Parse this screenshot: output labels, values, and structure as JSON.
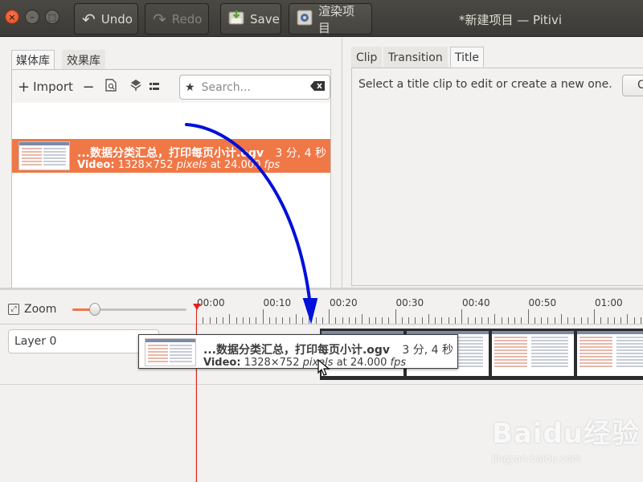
{
  "window": {
    "title": "*新建项目 — Pitivi",
    "controls": {
      "close": "×",
      "minimize": "–",
      "maximize": "□"
    }
  },
  "toolbar": {
    "undo": {
      "label": "Undo",
      "icon": "undo-arrow-icon"
    },
    "redo": {
      "label": "Redo",
      "icon": "redo-arrow-icon"
    },
    "save": {
      "label": "Save",
      "icon": "save-icon"
    },
    "render": {
      "label": "渲染项目",
      "icon": "render-gear-icon"
    }
  },
  "media_library": {
    "tabs": [
      "媒体库",
      "效果库"
    ],
    "active_tab": 0,
    "import_label": "Import",
    "search": {
      "placeholder": "Search...",
      "value": ""
    },
    "items": [
      {
        "name": "...数据分类汇总，打印每页小计.ogv",
        "duration": "3 分, 4 秒",
        "info_prefix": "Video:",
        "info_size": "1328×752",
        "info_unit": "pixels",
        "info_at": "at 24.000",
        "info_fps": "fps",
        "selected": true
      }
    ]
  },
  "clip_panel": {
    "tabs": [
      "Clip",
      "Transition",
      "Title"
    ],
    "active_tab": 2,
    "hint": "Select a title clip to edit or create a new one.",
    "create_button": "Create"
  },
  "timeline": {
    "zoom_label": "Zoom",
    "zoom_level": 0.2,
    "ruler_labels": [
      "00:00",
      "00:10",
      "00:20",
      "00:30",
      "00:40",
      "00:50",
      "01:00"
    ],
    "layer_name": "Layer 0"
  },
  "drag_tooltip": {
    "name": "...数据分类汇总，打印每页小计.ogv",
    "duration": "3 分, 4 秒",
    "info_prefix": "Video:",
    "info_size": "1328×752",
    "info_unit": "pixels",
    "info_at": "at 24.000",
    "info_fps": "fps"
  },
  "watermark": {
    "brand": "Baidu经验",
    "url": "jingyan.baidu.com"
  },
  "colors": {
    "accent": "#f07746",
    "header": "#3b3a36",
    "playhead": "#e0231c",
    "annotation_arrow": "#0010d8"
  }
}
